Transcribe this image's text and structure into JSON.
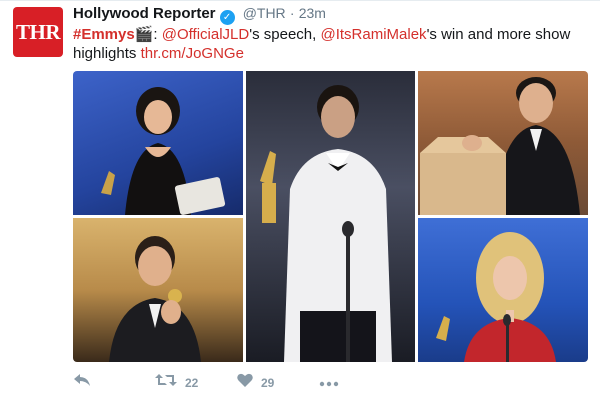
{
  "account": {
    "avatar_text": "THR",
    "name": "Hollywood Reporter",
    "handle": "@THR",
    "separator": "·",
    "time": "23m"
  },
  "tweet": {
    "hashtag": "#Emmys",
    "emoji": "🎬",
    "colon": ":",
    "mention1": "@OfficialJLD",
    "text1": "'s speech,",
    "mention2": "@ItsRamiMalek",
    "text2": "'s win and more show highlights",
    "link": "thr.cm/JoGNGe"
  },
  "actions": {
    "reply_icon": "reply-icon",
    "retweet_icon": "retweet-icon",
    "retweet_count": "22",
    "like_icon": "heart-icon",
    "like_count": "29",
    "more_icon": "more-icon"
  },
  "colors": {
    "brand": "#d81f26",
    "link": "#d4302c",
    "verified": "#1da1f2",
    "muted": "#657786"
  }
}
